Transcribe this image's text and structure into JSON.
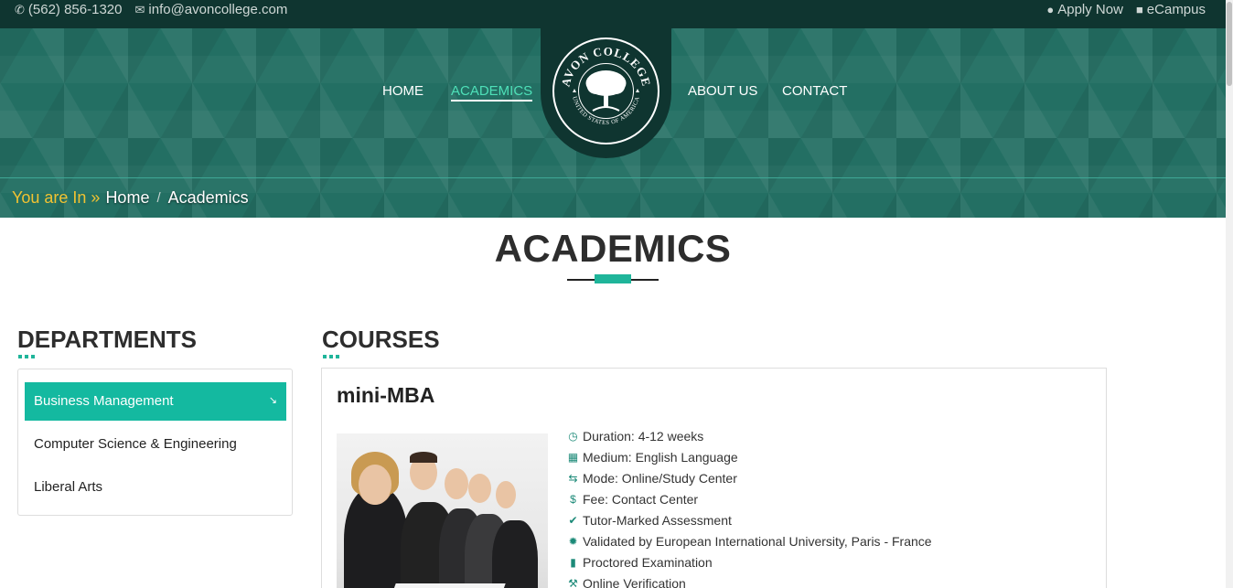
{
  "topbar": {
    "phone": "(562) 856-1320",
    "email": "info@avoncollege.com",
    "apply": "Apply Now",
    "ecampus": "eCampus"
  },
  "nav": {
    "home": "HOME",
    "academics": "ACADEMICS",
    "about": "ABOUT US",
    "contact": "CONTACT"
  },
  "logo": {
    "name": "AVON COLLEGE",
    "sub": "UNITED STATES OF AMERICA"
  },
  "breadcrumb": {
    "you_are_in": "You are In",
    "home": "Home",
    "separator": "/",
    "current": "Academics"
  },
  "page_title": "ACADEMICS",
  "departments": {
    "heading": "DEPARTMENTS",
    "items": [
      {
        "label": "Business Management"
      },
      {
        "label": "Computer Science & Engineering"
      },
      {
        "label": "Liberal Arts"
      }
    ]
  },
  "courses": {
    "heading": "COURSES",
    "course": {
      "title": "mini-MBA",
      "features": [
        {
          "icon": "clock-icon",
          "text": "Duration: 4-12 weeks"
        },
        {
          "icon": "language-icon",
          "text": "Medium: English Language"
        },
        {
          "icon": "exchange-icon",
          "text": "Mode: Online/Study Center"
        },
        {
          "icon": "dollar-icon",
          "text": "Fee: Contact Center"
        },
        {
          "icon": "check-circle-icon",
          "text": "Tutor-Marked Assessment"
        },
        {
          "icon": "certificate-icon",
          "text": "Validated by European International University, Paris - France"
        },
        {
          "icon": "file-icon",
          "text": "Proctored Examination"
        },
        {
          "icon": "gavel-icon",
          "text": "Online Verification"
        }
      ]
    }
  },
  "colors": {
    "accent": "#14b9a0",
    "header_bg": "#236f63",
    "topbar_bg": "#0f3530",
    "breadcrumb_label": "#f1c232"
  }
}
